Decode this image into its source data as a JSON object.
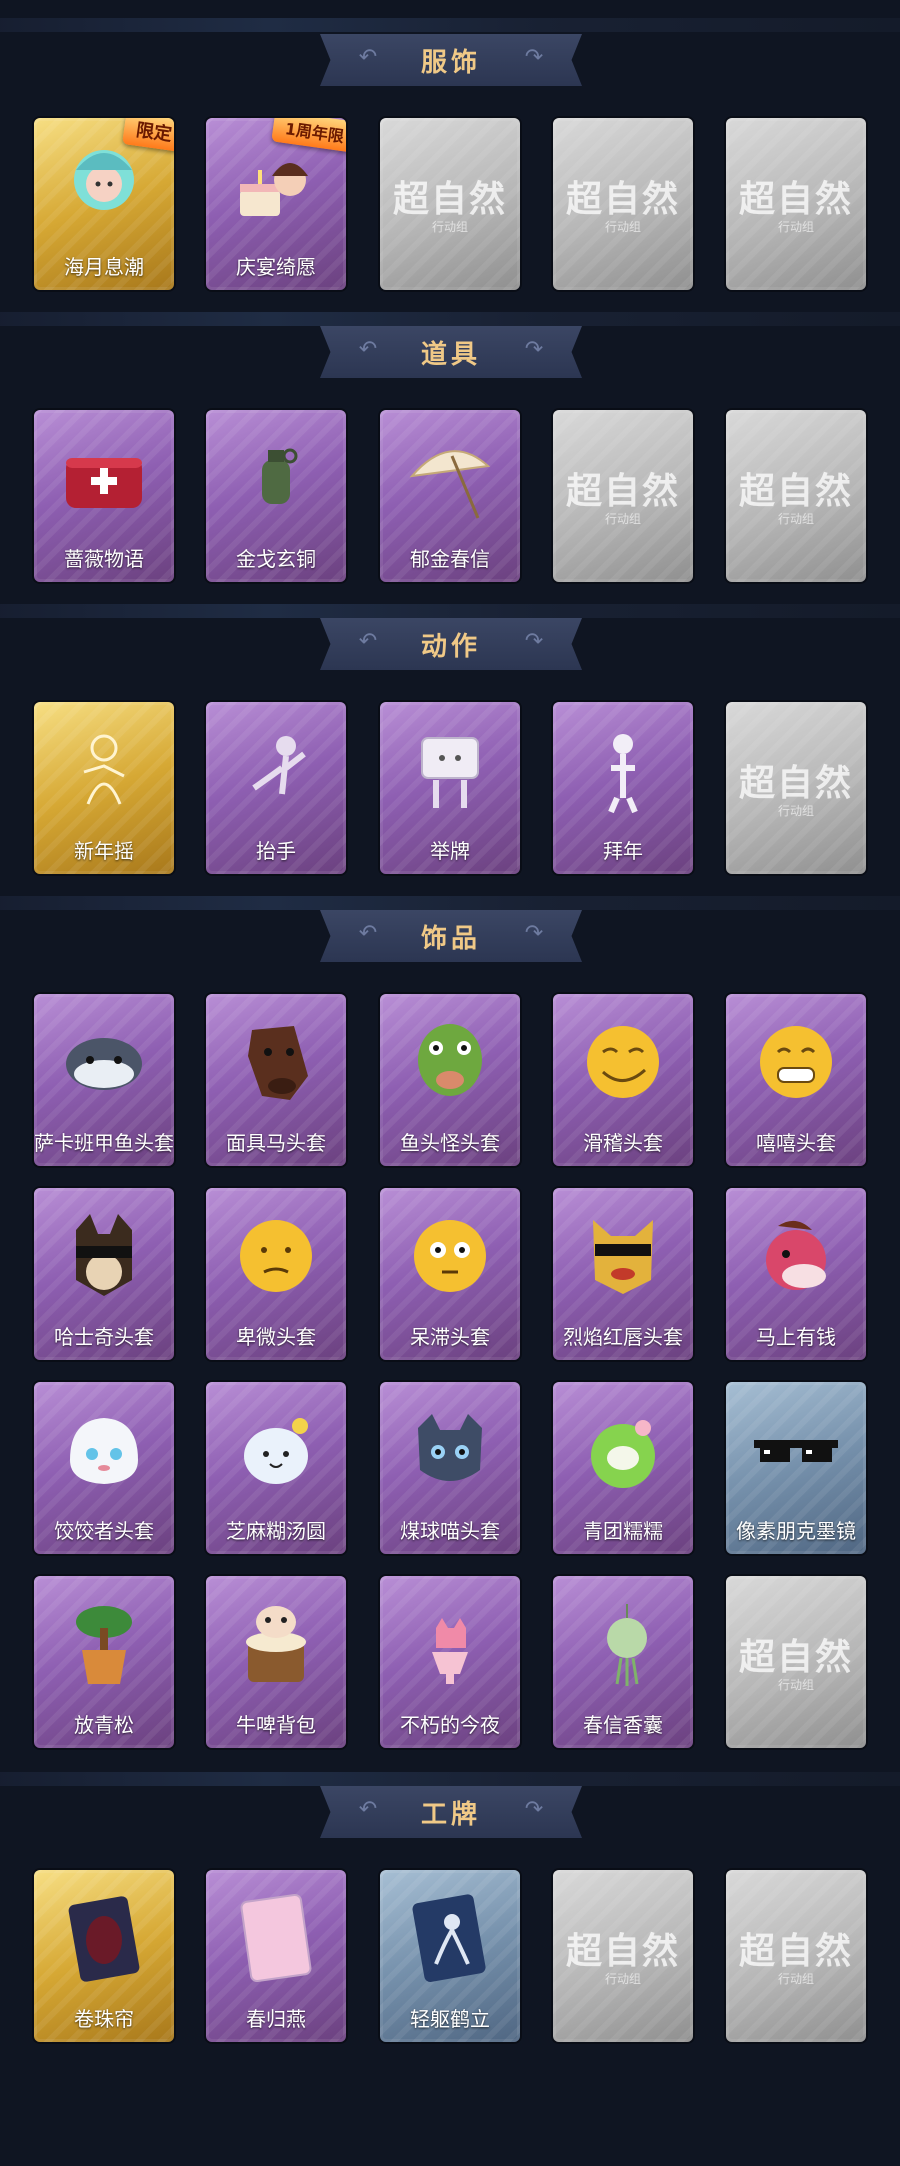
{
  "sections": [
    {
      "title": "服饰",
      "items": [
        {
          "label": "海月息潮",
          "tier": "gold",
          "badge": "限定",
          "icon": "mermaid-portrait-icon"
        },
        {
          "label": "庆宴绮愿",
          "tier": "purple",
          "badge": "1周年限",
          "icon": "cake-girl-portrait-icon"
        },
        {
          "label": "",
          "tier": "gray",
          "icon": "locked-placeholder-icon"
        },
        {
          "label": "",
          "tier": "gray",
          "icon": "locked-placeholder-icon"
        },
        {
          "label": "",
          "tier": "gray",
          "icon": "locked-placeholder-icon"
        }
      ]
    },
    {
      "title": "道具",
      "items": [
        {
          "label": "蔷薇物语",
          "tier": "purple",
          "icon": "medkit-icon"
        },
        {
          "label": "金戈玄铜",
          "tier": "purple",
          "icon": "grenade-icon"
        },
        {
          "label": "郁金春信",
          "tier": "purple",
          "icon": "umbrella-icon"
        },
        {
          "label": "",
          "tier": "gray",
          "icon": "locked-placeholder-icon"
        },
        {
          "label": "",
          "tier": "gray",
          "icon": "locked-placeholder-icon"
        }
      ]
    },
    {
      "title": "动作",
      "items": [
        {
          "label": "新年摇",
          "tier": "gold",
          "icon": "dance-figure-icon"
        },
        {
          "label": "抬手",
          "tier": "purple",
          "icon": "raise-hand-figure-icon"
        },
        {
          "label": "举牌",
          "tier": "purple",
          "icon": "sign-figure-icon"
        },
        {
          "label": "拜年",
          "tier": "purple",
          "icon": "bow-figure-icon"
        },
        {
          "label": "",
          "tier": "gray",
          "icon": "locked-placeholder-icon"
        }
      ]
    },
    {
      "title": "饰品",
      "items": [
        {
          "label": "萨卡班甲鱼头套",
          "tier": "purple",
          "icon": "fish-head-icon"
        },
        {
          "label": "面具马头套",
          "tier": "purple",
          "icon": "horse-head-icon"
        },
        {
          "label": "鱼头怪头套",
          "tier": "purple",
          "icon": "frog-fish-head-icon"
        },
        {
          "label": "滑稽头套",
          "tier": "purple",
          "icon": "smirk-emoji-icon"
        },
        {
          "label": "嘻嘻头套",
          "tier": "purple",
          "icon": "grin-emoji-icon"
        },
        {
          "label": "哈士奇头套",
          "tier": "purple",
          "icon": "husky-head-icon"
        },
        {
          "label": "卑微头套",
          "tier": "purple",
          "icon": "humble-emoji-icon"
        },
        {
          "label": "呆滞头套",
          "tier": "purple",
          "icon": "dazed-emoji-icon"
        },
        {
          "label": "烈焰红唇头套",
          "tier": "purple",
          "icon": "redlip-head-icon"
        },
        {
          "label": "马上有钱",
          "tier": "purple",
          "icon": "pink-horse-icon"
        },
        {
          "label": "饺饺者头套",
          "tier": "purple",
          "icon": "dumpling-head-icon"
        },
        {
          "label": "芝麻糊汤圆",
          "tier": "purple",
          "icon": "tangyuan-icon"
        },
        {
          "label": "煤球喵头套",
          "tier": "purple",
          "icon": "cat-head-icon"
        },
        {
          "label": "青团糯糯",
          "tier": "purple",
          "icon": "green-rice-ball-icon"
        },
        {
          "label": "像素朋克墨镜",
          "tier": "blue",
          "icon": "pixel-sunglasses-icon"
        },
        {
          "label": "放青松",
          "tier": "purple",
          "icon": "bonsai-icon"
        },
        {
          "label": "牛啤背包",
          "tier": "purple",
          "icon": "cow-beer-backpack-icon"
        },
        {
          "label": "不朽的今夜",
          "tier": "purple",
          "icon": "pink-cat-cup-icon"
        },
        {
          "label": "春信香囊",
          "tier": "purple",
          "icon": "sachet-icon"
        },
        {
          "label": "",
          "tier": "gray",
          "icon": "locked-placeholder-icon"
        }
      ]
    },
    {
      "title": "工牌",
      "items": [
        {
          "label": "卷珠帘",
          "tier": "gold",
          "icon": "badge-card-dark-icon"
        },
        {
          "label": "春归燕",
          "tier": "purple",
          "icon": "badge-card-pink-icon"
        },
        {
          "label": "轻躯鹤立",
          "tier": "blue",
          "icon": "badge-card-silhouette-icon"
        },
        {
          "label": "",
          "tier": "gray",
          "icon": "locked-placeholder-icon"
        },
        {
          "label": "",
          "tier": "gray",
          "icon": "locked-placeholder-icon"
        }
      ]
    }
  ],
  "placeholder": {
    "main": "超自然",
    "sub": "行动组"
  }
}
